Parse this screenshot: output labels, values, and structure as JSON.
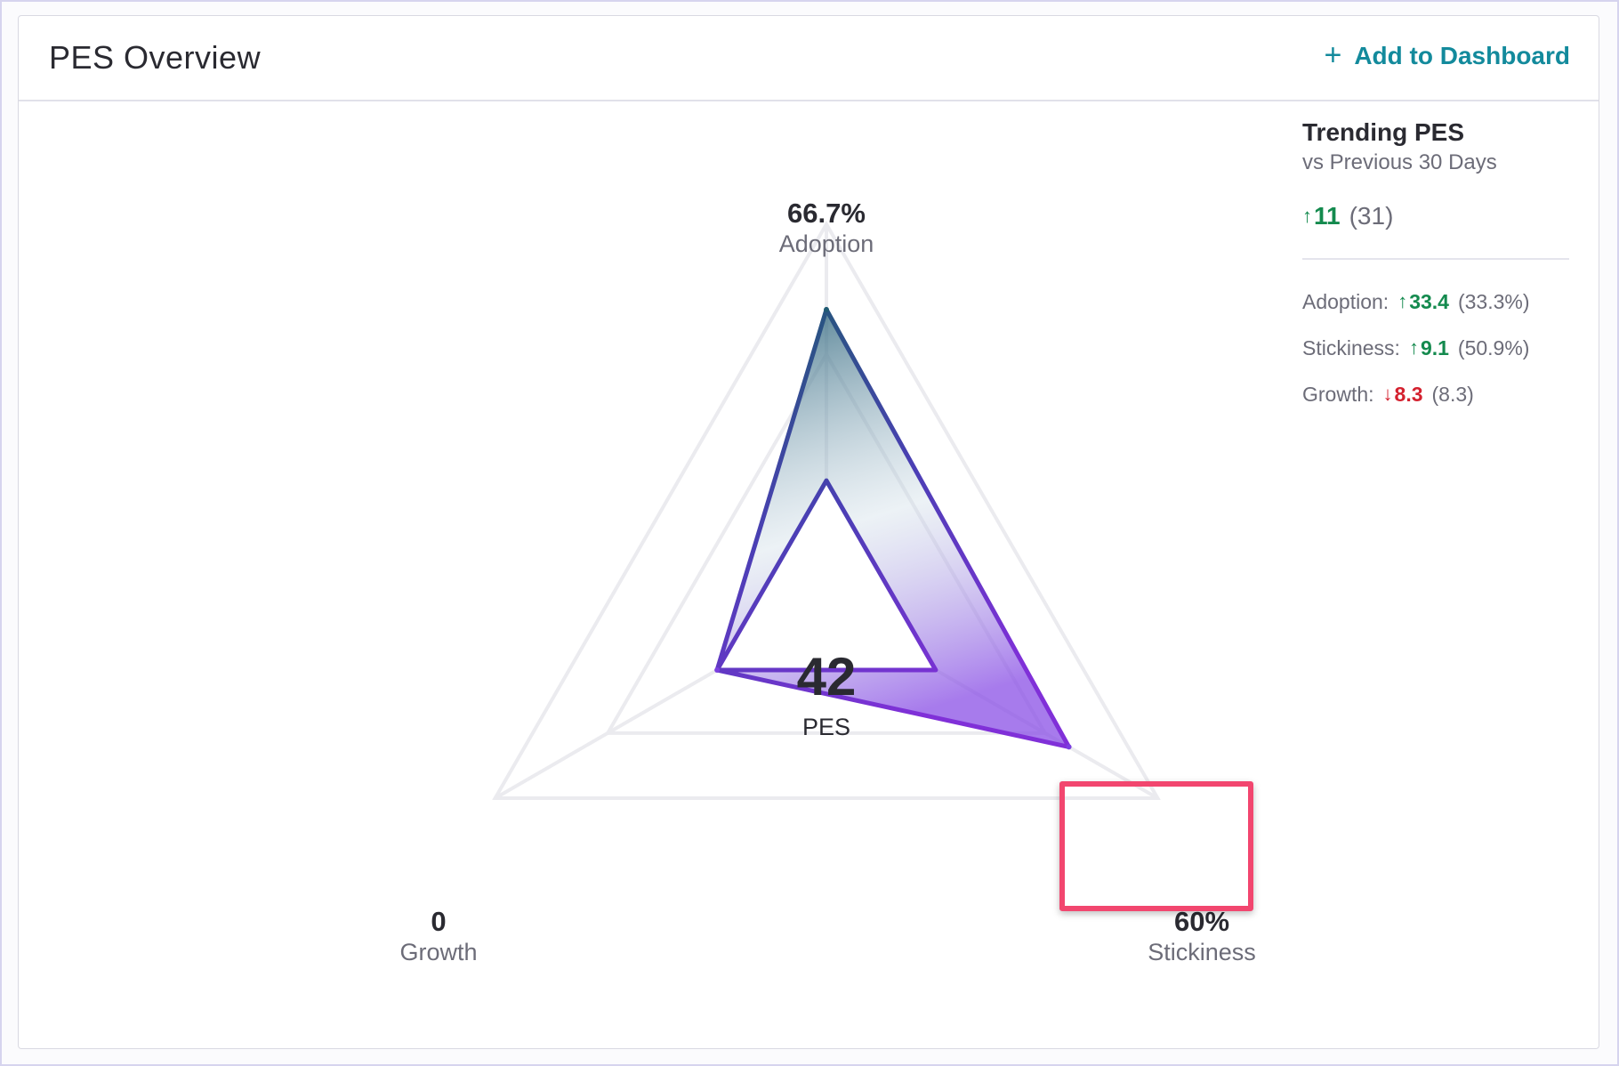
{
  "header": {
    "title": "PES Overview",
    "add_to_dashboard": "Add to Dashboard",
    "plus_symbol": "+"
  },
  "chart_data": {
    "type": "radar",
    "center": {
      "value": "42",
      "label": "PES"
    },
    "axes": [
      {
        "name": "Adoption",
        "display": "66.7%",
        "value": 66.7
      },
      {
        "name": "Stickiness",
        "display": "60%",
        "value": 60
      },
      {
        "name": "Growth",
        "display": "0",
        "value": 0
      }
    ],
    "range": [
      0,
      100
    ]
  },
  "trending": {
    "title": "Trending PES",
    "subtitle": "vs Previous 30 Days",
    "overall": {
      "arrow": "↑",
      "delta": "11",
      "previous": "(31)"
    },
    "metrics": [
      {
        "name": "Adoption:",
        "arrow": "↑",
        "delta": "33.4",
        "previous": "(33.3%)",
        "direction": "up"
      },
      {
        "name": "Stickiness:",
        "arrow": "↑",
        "delta": "9.1",
        "previous": "(50.9%)",
        "direction": "up"
      },
      {
        "name": "Growth:",
        "arrow": "↓",
        "delta": "8.3",
        "previous": "(8.3)",
        "direction": "down"
      }
    ]
  },
  "colors": {
    "accent": "#138a9c",
    "up": "#148a4e",
    "down": "#d4212f",
    "highlight": "#f2466f",
    "grid": "#ebebef",
    "shape_top": "#1f5a72",
    "shape_bottom": "#7b3fe0"
  }
}
